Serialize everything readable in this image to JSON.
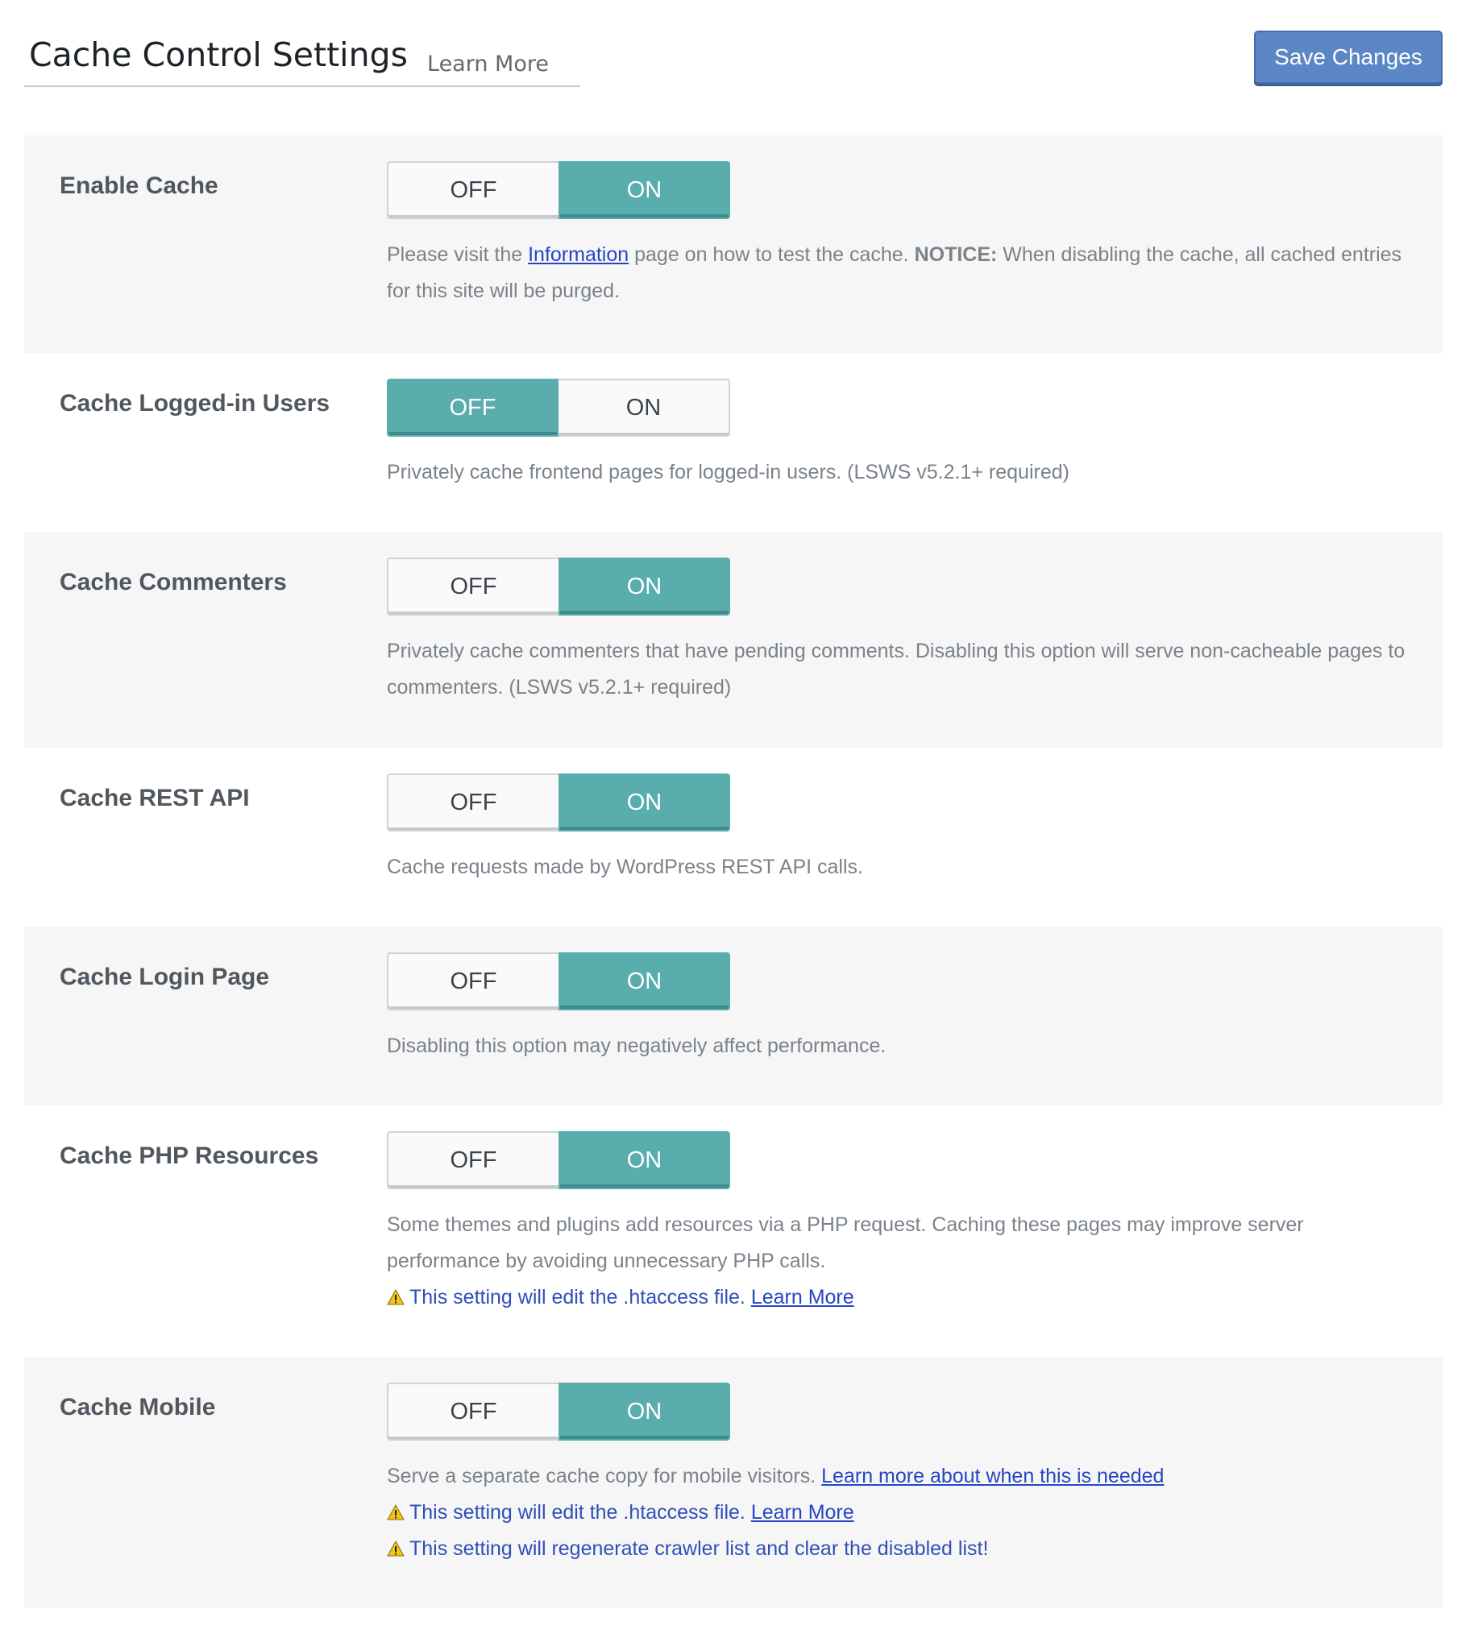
{
  "header": {
    "title": "Cache Control Settings",
    "learn_more": "Learn More",
    "save_label": "Save Changes"
  },
  "toggle_labels": {
    "off": "OFF",
    "on": "ON"
  },
  "settings": [
    {
      "label": "Enable Cache",
      "value": "ON",
      "desc": {
        "prefix": "Please visit the ",
        "link": "Information",
        "middle": " page on how to test the cache. ",
        "notice": "NOTICE:",
        "suffix": " When disabling the cache, all cached entries for this site will be purged."
      }
    },
    {
      "label": "Cache Logged-in Users",
      "value": "OFF",
      "desc": "Privately cache frontend pages for logged-in users. (LSWS v5.2.1+ required)"
    },
    {
      "label": "Cache Commenters",
      "value": "ON",
      "desc": "Privately cache commenters that have pending comments. Disabling this option will serve non-cacheable pages to commenters. (LSWS v5.2.1+ required)"
    },
    {
      "label": "Cache REST API",
      "value": "ON",
      "desc": "Cache requests made by WordPress REST API calls."
    },
    {
      "label": "Cache Login Page",
      "value": "ON",
      "desc": "Disabling this option may negatively affect performance."
    },
    {
      "label": "Cache PHP Resources",
      "value": "ON",
      "desc": "Some themes and plugins add resources via a PHP request. Caching these pages may improve server performance by avoiding unnecessary PHP calls.",
      "warning": "This setting will edit the .htaccess file.",
      "warning_link": "Learn More"
    },
    {
      "label": "Cache Mobile",
      "value": "ON",
      "desc": "Serve a separate cache copy for mobile visitors.",
      "desc_link": "Learn more about when this is needed",
      "warning": "This setting will edit the .htaccess file.",
      "warning_link": "Learn More",
      "warning2": "This setting will regenerate crawler list and clear the disabled list!"
    }
  ],
  "colors": {
    "toggle_active": "#5aadad",
    "save_button": "#5b87c6",
    "link": "#2546c4",
    "row_shade": "#f6f6f7"
  },
  "icons": {
    "warning": "warning-triangle-icon"
  }
}
